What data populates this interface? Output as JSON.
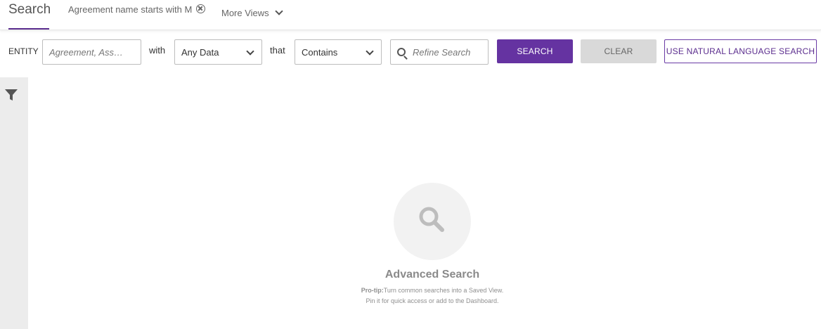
{
  "tabs": {
    "search": "Search",
    "saved_view": "Agreement name starts with M",
    "more_views": "More Views"
  },
  "filters": {
    "entity_label": "ENTITY",
    "entity_placeholder": "Agreement, Ass…",
    "with_label": "with",
    "data_select": "Any Data",
    "that_label": "that",
    "operator_select": "Contains",
    "refine_placeholder": "Refine Search"
  },
  "buttons": {
    "search": "SEARCH",
    "clear": "CLEAR",
    "natural_language": "USE NATURAL LANGUAGE SEARCH"
  },
  "empty_state": {
    "title": "Advanced Search",
    "protip_label": "Pro-tip:",
    "protip_line1": "Turn common searches into a Saved View.",
    "protip_line2": "Pin it for quick access or add to the Dashboard."
  },
  "icons": {
    "close": "close-circle-icon",
    "more": "chevron-down-icon",
    "select": "chevron-down-icon",
    "refine": "search-icon",
    "filter": "filter-funnel-icon",
    "empty": "search-icon"
  },
  "colors": {
    "accent": "#6533a1",
    "clear_bg": "#d9d9d9",
    "sidebar_bg": "#ececec"
  }
}
